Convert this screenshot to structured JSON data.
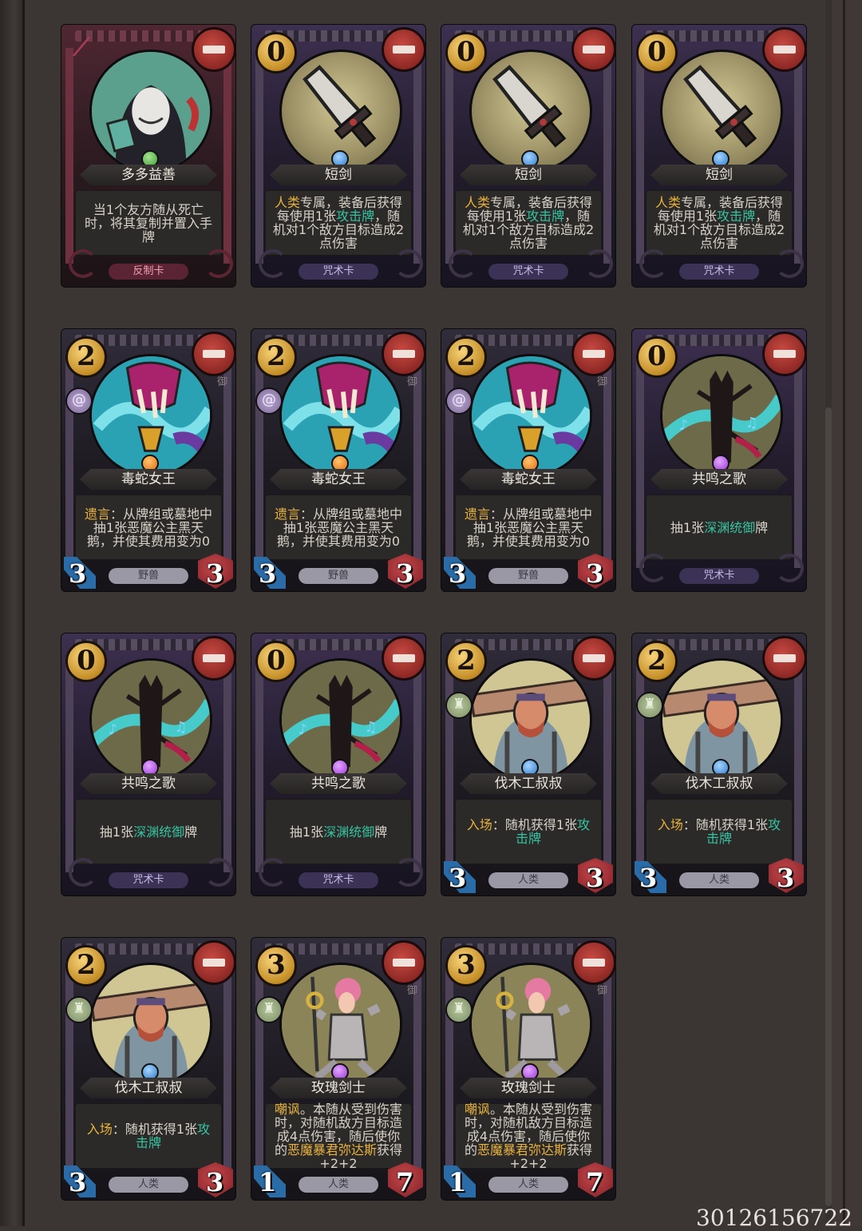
{
  "watermark": "30126156722",
  "cards": [
    {
      "name": "多多益善",
      "cost": "",
      "faction_mark": "⟋",
      "type": "反制卡",
      "theme": "red",
      "gem": "green",
      "art": "hooded",
      "desc": [
        [
          "",
          "当1个友方随从死亡时，将其复制并置入手牌"
        ]
      ]
    },
    {
      "name": "短剑",
      "cost": "0",
      "type": "咒术卡",
      "theme": "purple",
      "gem": "blue",
      "art": "sword",
      "desc": [
        [
          "gold",
          "人类"
        ],
        [
          "",
          "专属，装备后获得每使用1张"
        ],
        [
          "teal",
          "攻击牌"
        ],
        [
          "",
          "，随机对1个敌方目标造成2点伤害"
        ]
      ]
    },
    {
      "name": "短剑",
      "cost": "0",
      "type": "咒术卡",
      "theme": "purple",
      "gem": "blue",
      "art": "sword",
      "desc": [
        [
          "gold",
          "人类"
        ],
        [
          "",
          "专属，装备后获得每使用1张"
        ],
        [
          "teal",
          "攻击牌"
        ],
        [
          "",
          "，随机对1个敌方目标造成2点伤害"
        ]
      ]
    },
    {
      "name": "短剑",
      "cost": "0",
      "type": "咒术卡",
      "theme": "purple",
      "gem": "blue",
      "art": "sword",
      "desc": [
        [
          "gold",
          "人类"
        ],
        [
          "",
          "专属，装备后获得每使用1张"
        ],
        [
          "teal",
          "攻击牌"
        ],
        [
          "",
          "，随机对1个敌方目标造成2点伤害"
        ]
      ]
    },
    {
      "name": "毒蛇女王",
      "cost": "2",
      "type": "野兽",
      "theme": "dark",
      "minion": true,
      "atk": "3",
      "hp": "3",
      "keyword": "spiral",
      "side": "御",
      "gem": "orange",
      "art": "serpent",
      "desc": [
        [
          "gold",
          "遗言"
        ],
        [
          "",
          "：从牌组或墓地中抽1张恶魔公主黑天鹅，并使其费用变为0"
        ]
      ]
    },
    {
      "name": "毒蛇女王",
      "cost": "2",
      "type": "野兽",
      "theme": "dark",
      "minion": true,
      "atk": "3",
      "hp": "3",
      "keyword": "spiral",
      "side": "御",
      "gem": "orange",
      "art": "serpent",
      "desc": [
        [
          "gold",
          "遗言"
        ],
        [
          "",
          "：从牌组或墓地中抽1张恶魔公主黑天鹅，并使其费用变为0"
        ]
      ]
    },
    {
      "name": "毒蛇女王",
      "cost": "2",
      "type": "野兽",
      "theme": "dark",
      "minion": true,
      "atk": "3",
      "hp": "3",
      "keyword": "spiral",
      "side": "御",
      "gem": "orange",
      "art": "serpent",
      "desc": [
        [
          "gold",
          "遗言"
        ],
        [
          "",
          "：从牌组或墓地中抽1张恶魔公主黑天鹅，并使其费用变为0"
        ]
      ]
    },
    {
      "name": "共鸣之歌",
      "cost": "0",
      "type": "咒术卡",
      "theme": "purple",
      "gem": "purple",
      "art": "song",
      "desc": [
        [
          "",
          "抽1张"
        ],
        [
          "teal",
          "深渊统御"
        ],
        [
          "",
          "牌"
        ]
      ]
    },
    {
      "name": "共鸣之歌",
      "cost": "0",
      "type": "咒术卡",
      "theme": "purple",
      "gem": "purple",
      "art": "song",
      "desc": [
        [
          "",
          "抽1张"
        ],
        [
          "teal",
          "深渊统御"
        ],
        [
          "",
          "牌"
        ]
      ]
    },
    {
      "name": "共鸣之歌",
      "cost": "0",
      "type": "咒术卡",
      "theme": "purple",
      "gem": "purple",
      "art": "song",
      "desc": [
        [
          "",
          "抽1张"
        ],
        [
          "teal",
          "深渊统御"
        ],
        [
          "",
          "牌"
        ]
      ]
    },
    {
      "name": "伐木工叔叔",
      "cost": "2",
      "type": "人类",
      "theme": "dark",
      "minion": true,
      "atk": "3",
      "hp": "3",
      "keyword": "stump",
      "gem": "blue",
      "art": "lumber",
      "desc": [
        [
          "gold",
          "入场"
        ],
        [
          "",
          "：随机获得1张"
        ],
        [
          "teal",
          "攻击牌"
        ]
      ]
    },
    {
      "name": "伐木工叔叔",
      "cost": "2",
      "type": "人类",
      "theme": "dark",
      "minion": true,
      "atk": "3",
      "hp": "3",
      "keyword": "stump",
      "gem": "blue",
      "art": "lumber",
      "desc": [
        [
          "gold",
          "入场"
        ],
        [
          "",
          "：随机获得1张"
        ],
        [
          "teal",
          "攻击牌"
        ]
      ]
    },
    {
      "name": "伐木工叔叔",
      "cost": "2",
      "type": "人类",
      "theme": "dark",
      "minion": true,
      "atk": "3",
      "hp": "3",
      "keyword": "stump",
      "gem": "blue",
      "art": "lumber",
      "desc": [
        [
          "gold",
          "入场"
        ],
        [
          "",
          "：随机获得1张"
        ],
        [
          "teal",
          "攻击牌"
        ]
      ]
    },
    {
      "name": "玫瑰剑士",
      "cost": "3",
      "type": "人类",
      "theme": "dark",
      "minion": true,
      "atk": "1",
      "hp": "7",
      "keyword": "stump",
      "side": "御",
      "gem": "purple",
      "art": "rose",
      "desc": [
        [
          "gold",
          "嘲讽"
        ],
        [
          "",
          "。本随从受到伤害时，对随机敌方目标造成4点伤害，随后使你的"
        ],
        [
          "gold",
          "恶魔暴君弥达斯"
        ],
        [
          "",
          "获得+2+2"
        ]
      ]
    },
    {
      "name": "玫瑰剑士",
      "cost": "3",
      "type": "人类",
      "theme": "dark",
      "minion": true,
      "atk": "1",
      "hp": "7",
      "keyword": "stump",
      "side": "御",
      "gem": "purple",
      "art": "rose",
      "desc": [
        [
          "gold",
          "嘲讽"
        ],
        [
          "",
          "。本随从受到伤害时，对随机敌方目标造成4点伤害，随后使你的"
        ],
        [
          "gold",
          "恶魔暴君弥达斯"
        ],
        [
          "",
          "获得+2+2"
        ]
      ]
    }
  ]
}
